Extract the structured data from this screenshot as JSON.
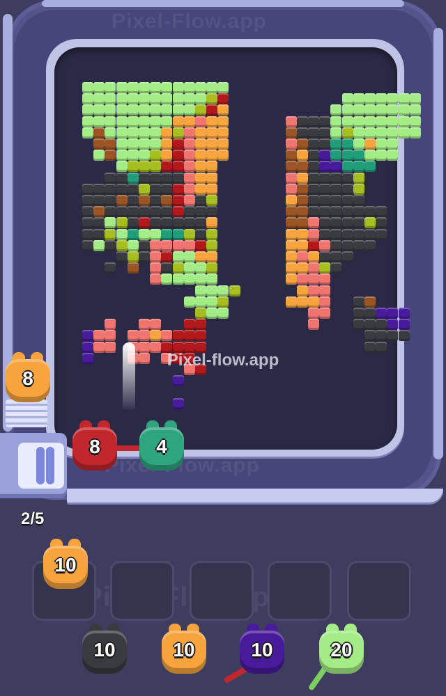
{
  "watermarks": {
    "center": "Pixel-flow.app",
    "top": "Pixel-Flow.app",
    "bottom": "Pixel-Flow.app",
    "tray": "Pixel-Flow.app",
    "side": "Pixel-Flow.app"
  },
  "capacity_counter": "2/5",
  "conveyor_queue": [
    {
      "color": "#f7a43f",
      "dark": "#c9771f",
      "value": "8"
    }
  ],
  "active_shooters": [
    {
      "color": "#c2272d",
      "dark": "#8a1418",
      "value": "8"
    },
    {
      "color": "#2fa57f",
      "dark": "#1d7258",
      "value": "4"
    }
  ],
  "holding_slots": [
    {
      "color": "#f7a43f",
      "dark": "#c9771f",
      "value": "10"
    },
    null,
    null,
    null,
    null
  ],
  "deck_pigs": [
    {
      "color": "#3a3b40",
      "dark": "#1f2024",
      "value": "10"
    },
    {
      "color": "#f7a43f",
      "dark": "#c9771f",
      "value": "10"
    },
    {
      "color": "#4a1a9c",
      "dark": "#2e0f66",
      "value": "10"
    },
    {
      "color": "#a4ec85",
      "dark": "#6fb556",
      "value": "20"
    }
  ],
  "palette": [
    "#a4ec85",
    "#f7a43f",
    "#393b40",
    "#f07570",
    "#b2191d",
    "#9b5525",
    "#1f9e79",
    "#a7be20",
    "#4a1a9c"
  ],
  "pixel_art_rows": [
    "GGGGGGGGGGGGG...................",
    "GGGGGGGGGGGYR..........GGGGGGG..",
    "GGGGGGGGGGYRO.........GGGGGGGG..",
    "GGGGGGGGOOPOO.....PKKKGGGGGGGG..",
    "GBGGGGGOYPOOO.....BKKKGYGGGGGG..",
    ".BBGGGGORPOOO.....PBKKTTGOGG....",
    ".GBGGGYORPOOO.....BOKVTTTGGG....",
    "...GYYYRRPOO......BBKVVTTT......",
    "..KKTKKKKPOO......POKKKKY.......",
    "KKKKKYKKRPOO......PBKKKKY.......",
    "KKKBKBKBRPKY......OBKKKKK.......",
    "KBKKKKKKRKKK......BBKKKKKKK.....",
    "KKGYKRKKKKKO......BBPKKKKYK.....",
    "KKYGTGGTTYKY......OOPKKKKKK.....",
    "KGKYGKPPPPRY......OORPKKKK......",
    "...KYKPRGGOO......OPOKKK........",
    "..K.B.PKYGGY......OOPYK.........",
    "......PGGGGG......OPPP..........",
    "..........GGGY.....OPP..........",
    ".........GGGY.....OOOP..KB......",
    "..........YGG.......PP..KKVVV...",
    "..P..PP..RR.........P...KKKVV...",
    "VPP.PPOPRRR..............KKKK...",
    "VPP.PPPRRRR..............KK.....",
    "V...PP.PRR.....................",
    ".........PR.....................",
    "........V.......................",
    "................................",
    "........V......................."
  ]
}
